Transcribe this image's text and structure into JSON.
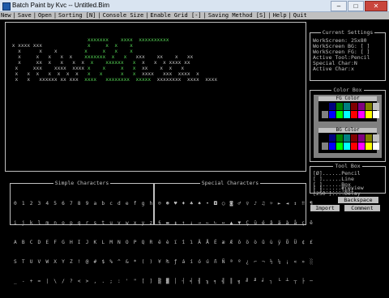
{
  "window": {
    "title": "Batch Paint by Kvc -- Untitled.Bim",
    "minimize": "–",
    "maximize": "□",
    "close": "✕"
  },
  "menu": [
    "New",
    "Save",
    "Open",
    "Sorting [N]",
    "Console Size",
    "Enable Grid [-]",
    "Saving Method [S]",
    "Help",
    "Quit"
  ],
  "canvas_rows": [
    {
      "segments": [
        {
          "t": "                          ",
          "c": "w"
        },
        {
          "t": "xxxxxxx",
          "c": "g"
        },
        {
          "t": "    ",
          "c": "w"
        },
        {
          "t": "xxxx",
          "c": "g"
        },
        {
          "t": "  ",
          "c": "w"
        },
        {
          "t": "xxxxxxxxxx",
          "c": "g"
        }
      ]
    },
    {
      "segments": [
        {
          "t": " x xxxx xxx",
          "c": "w"
        },
        {
          "t": "               ",
          "c": "w"
        },
        {
          "t": "x",
          "c": "g"
        },
        {
          "t": "     ",
          "c": "w"
        },
        {
          "t": "x  x",
          "c": "g"
        },
        {
          "t": "    ",
          "c": "w"
        },
        {
          "t": "x",
          "c": "g"
        }
      ]
    },
    {
      "segments": [
        {
          "t": "   x      x    x",
          "c": "w"
        },
        {
          "t": "         ",
          "c": "w"
        },
        {
          "t": "x",
          "c": "g"
        },
        {
          "t": "     ",
          "c": "w"
        },
        {
          "t": "x   x",
          "c": "g"
        },
        {
          "t": "    ",
          "c": "w"
        },
        {
          "t": "x",
          "c": "g"
        }
      ]
    },
    {
      "segments": [
        {
          "t": "   x     x   x   x  x",
          "c": "w"
        },
        {
          "t": "    ",
          "c": "w"
        },
        {
          "t": "xxxxxxx",
          "c": "g"
        },
        {
          "t": "  ",
          "c": "w"
        },
        {
          "t": "x",
          "c": "g"
        },
        {
          "t": "   ",
          "c": "w"
        },
        {
          "t": "x",
          "c": "g"
        },
        {
          "t": "   xxx    xx    x   xx",
          "c": "w"
        }
      ]
    },
    {
      "segments": [
        {
          "t": "   x     xx  x   x   x  x",
          "c": "w"
        },
        {
          "t": "  ",
          "c": "g"
        },
        {
          "t": "x",
          "c": "g"
        },
        {
          "t": "    ",
          "c": "w"
        },
        {
          "t": "xxxxxx",
          "c": "g"
        },
        {
          "t": "   ",
          "c": "w"
        },
        {
          "t": "x",
          "c": "g"
        },
        {
          "t": "  x   x  x xxxx xx",
          "c": "w"
        }
      ]
    },
    {
      "segments": [
        {
          "t": "  x     xxx    xxxx  xxxx ",
          "c": "w"
        },
        {
          "t": "x",
          "c": "g"
        },
        {
          "t": "    ",
          "c": "w"
        },
        {
          "t": "x     x",
          "c": "g"
        },
        {
          "t": "   ",
          "c": "w"
        },
        {
          "t": "x",
          "c": "g"
        },
        {
          "t": "  xx    x  x   x",
          "c": "w"
        }
      ]
    },
    {
      "segments": [
        {
          "t": "  x   x  x   x  x  x  x",
          "c": "w"
        },
        {
          "t": "   ",
          "c": "w"
        },
        {
          "t": "x",
          "c": "g"
        },
        {
          "t": "   ",
          "c": "w"
        },
        {
          "t": "x      x",
          "c": "g"
        },
        {
          "t": "   ",
          "c": "w"
        },
        {
          "t": "x",
          "c": "g"
        },
        {
          "t": "  xxxx   xxx  xxxx  x",
          "c": "w"
        }
      ]
    },
    {
      "segments": [
        {
          "t": "  x   x   xxxxxx xx xxx",
          "c": "w"
        },
        {
          "t": "  ",
          "c": "w"
        },
        {
          "t": "xxxx",
          "c": "g"
        },
        {
          "t": "   ",
          "c": "w"
        },
        {
          "t": "xxxxxxxx",
          "c": "g"
        },
        {
          "t": "  ",
          "c": "w"
        },
        {
          "t": "xxxxx",
          "c": "g"
        },
        {
          "t": "  xxxxxxxx  xxxx  xxxx",
          "c": "w"
        }
      ]
    }
  ],
  "settings": {
    "title": "Current Settings",
    "lines": [
      "WorkScreen: 25x80",
      "WorkScreen BG: [ ]",
      "WorkScreen FG: [ ]",
      "Active Tool:Pencil",
      "Special Char:N",
      "Active Char:x"
    ]
  },
  "colorbox": {
    "title": "Color Box",
    "fg_label": "FG Color",
    "bg_label": "BG Color",
    "colors": [
      "#000000",
      "#000080",
      "#008000",
      "#008080",
      "#800000",
      "#800080",
      "#808000",
      "#c0c0c0",
      "#808080",
      "#0000ff",
      "#00ff00",
      "#00ffff",
      "#ff0000",
      "#ff00ff",
      "#ffff00",
      "#ffffff"
    ]
  },
  "toolbox": {
    "title": "Tool Box",
    "lines": [
      "[Ø]......Pencil",
      "[ ]......Line",
      "[ ]......Box",
      "[ ]......Text"
    ]
  },
  "preview": {
    "preview_line": "[ ]......Preview",
    "delay_line": "[250 ]....Delay"
  },
  "buttons": {
    "backspace": "Backspace",
    "import": "Import",
    "comment": "Comment"
  },
  "simple_chars": {
    "title": "Simple Characters",
    "rows": [
      "0 1 2 3 4 5 6 7 8 9 a b c d e f g h",
      "i j k l m n o p q r s t u v w x y z",
      "A B C D E F G H I J K L M N O P Q R",
      "S T U V W X Y Z ! @ # $ % ^ & * ( )",
      "_ - + = | \\ / ? < > , . ; : ' \" [ ]"
    ]
  },
  "special_chars": {
    "title": "Special Characters",
    "rows": [
      "☺ ☻ ♥ ♦ ♣ ♠ • ◘ ○ ◙ ♂ ♀ ♪ ♫ ☼ ► ◄ ↕ ‼ ¶",
      "§ ▬ ↨ ↑ ↓ → ← ∟ ↔ ▲ ▼ Ç ü é â ä à å ç ê",
      "ë è ï î ì Ä Å É æ Æ ô ö ò û ù ÿ Ö Ü ¢ £",
      "¥ ₧ ƒ á í ó ú ñ Ñ ª º ¿ ⌐ ¬ ½ ¼ ¡ « » ░",
      "▒ ▓ │ ┤ ╡ ╢ ╖ ╕ ╣ ║ ╗ ╝ ╜ ╛ ┐ └ ┴ ┬ ├ ─"
    ]
  }
}
